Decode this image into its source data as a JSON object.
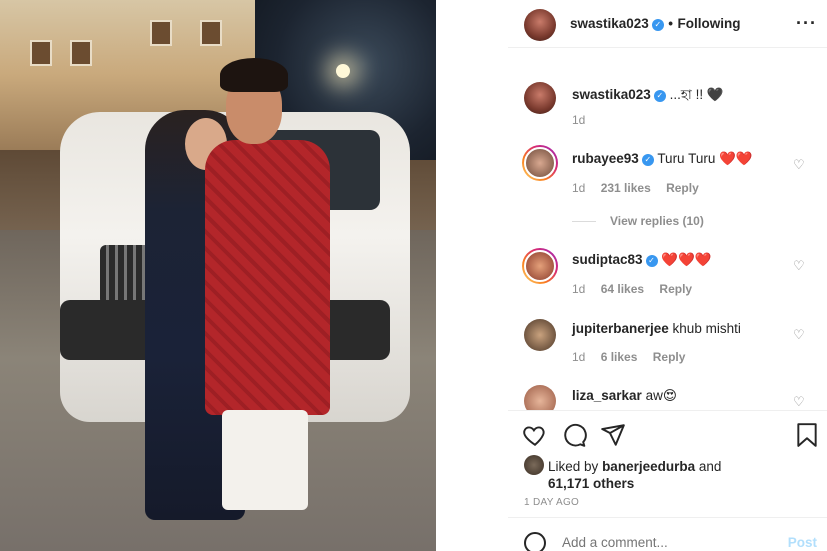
{
  "post": {
    "owner_username": "swastika023",
    "separator": "•",
    "follow_status": "Following",
    "more_icon": "more-dots-icon"
  },
  "caption": {
    "username": "swastika023",
    "text": "...হা !! 🖤",
    "time": "1d"
  },
  "comments": [
    {
      "username": "rubayee93",
      "verified": true,
      "text": "Turu Turu ❤️❤️",
      "time": "1d",
      "likes": "231 likes",
      "reply": "Reply",
      "view_replies": "View replies (10)"
    },
    {
      "username": "sudiptac83",
      "verified": true,
      "text": "❤️❤️❤️",
      "time": "1d",
      "likes": "64 likes",
      "reply": "Reply"
    },
    {
      "username": "jupiterbanerjee",
      "verified": false,
      "text": "khub mishti",
      "time": "1d",
      "likes": "6 likes",
      "reply": "Reply"
    },
    {
      "username": "liza_sarkar",
      "verified": false,
      "text": "aw😍"
    }
  ],
  "likes": {
    "prefix": "Liked by",
    "user": "banerjeedurba",
    "and": "and",
    "count": "61,171 others"
  },
  "timestamp": "1 DAY AGO",
  "add_comment": {
    "placeholder": "Add a comment...",
    "post_label": "Post"
  },
  "colors": {
    "verified": "#3897f0",
    "text": "#262626",
    "muted": "#8e8e8e",
    "post_disabled": "#b2dffc"
  }
}
